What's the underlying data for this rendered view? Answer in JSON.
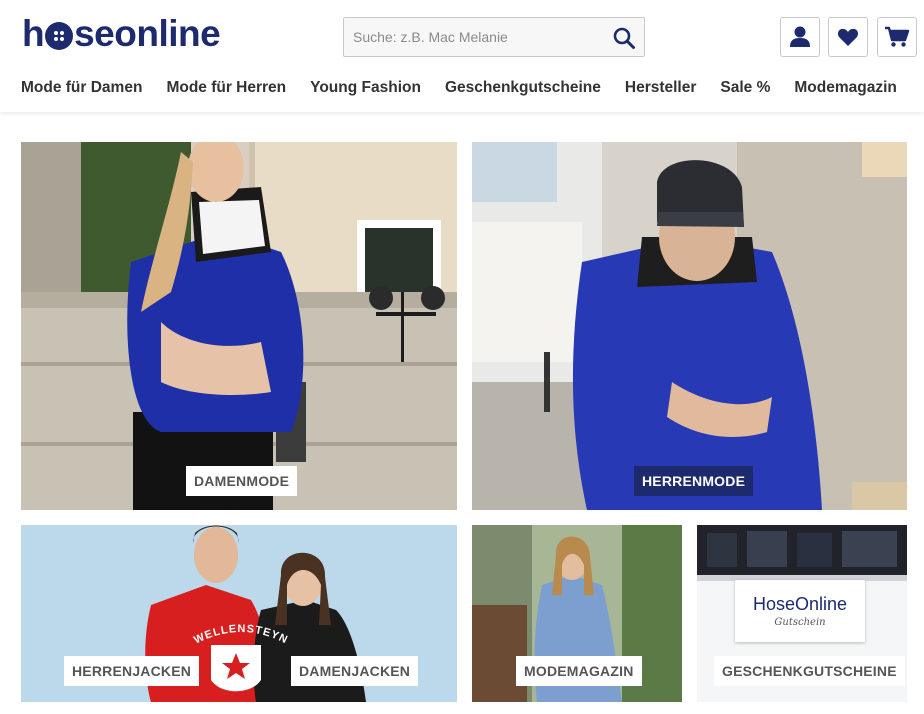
{
  "header": {
    "logo_text_before": "h",
    "logo_text_after": "seonline",
    "search_placeholder": "Suche: z.B. Mac Melanie",
    "icons": {
      "search": "search-icon",
      "account": "user-icon",
      "wishlist": "heart-icon",
      "cart": "cart-icon"
    }
  },
  "nav": {
    "items": [
      {
        "label": "Mode für Damen"
      },
      {
        "label": "Mode für Herren"
      },
      {
        "label": "Young Fashion"
      },
      {
        "label": "Geschenkgutscheine"
      },
      {
        "label": "Hersteller"
      },
      {
        "label": "Sale %"
      },
      {
        "label": "Modemagazin"
      }
    ]
  },
  "tiles": {
    "damenmode": {
      "label": "DAMENMODE"
    },
    "herrenmode": {
      "label": "HERRENMODE"
    },
    "herrenjacken": {
      "label": "HERRENJACKEN"
    },
    "damenjacken": {
      "label": "DAMENJACKEN"
    },
    "modemagazin": {
      "label": "MODEMAGAZIN"
    },
    "geschenkgutscheine": {
      "label": "GESCHENKGUTSCHEINE"
    },
    "jacket_brand_print": "WELLENSTEYN",
    "gutschein_card_title": "HoseOnline",
    "gutschein_card_subtitle": "Gutschein"
  },
  "colors": {
    "brand_navy": "#1d2a6e",
    "label_bg": "#ffffff",
    "label_text": "#555555"
  }
}
